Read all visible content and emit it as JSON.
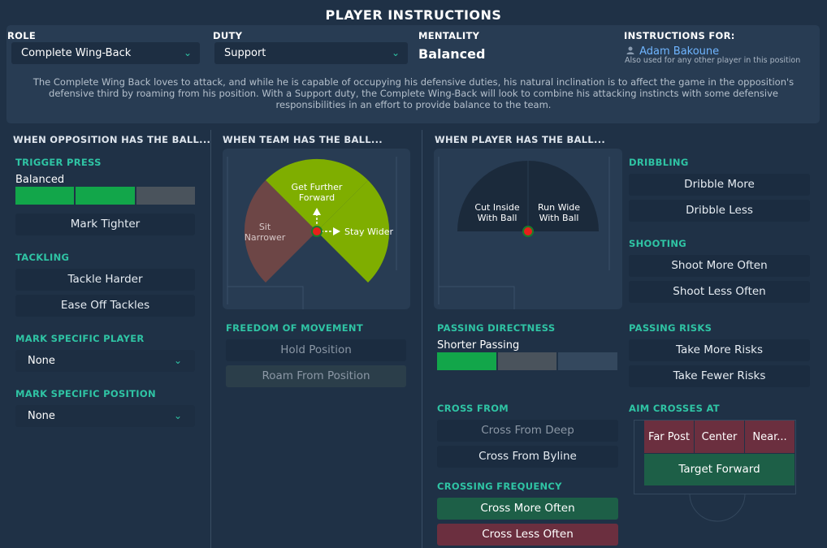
{
  "title": "PLAYER INSTRUCTIONS",
  "role": {
    "label": "ROLE",
    "value": "Complete Wing-Back"
  },
  "duty": {
    "label": "DUTY",
    "value": "Support"
  },
  "mentality": {
    "label": "MENTALITY",
    "value": "Balanced"
  },
  "instructions_for": {
    "label": "INSTRUCTIONS FOR:",
    "player": "Adam Bakoune",
    "note": "Also used for any other player in this position"
  },
  "description_1": "The Complete Wing Back loves to attack, and while he is capable of occupying his defensive duties, his natural inclination is to affect the game in the opposition's",
  "description_2": "defensive third by roaming from his position. With a Support duty, the Complete Wing-Back will look to combine his attacking instincts with some defensive",
  "description_3": "responsibilities in an effort to provide balance to the team.",
  "opposition": {
    "heading": "WHEN OPPOSITION HAS THE BALL...",
    "trigger_press": {
      "label": "TRIGGER PRESS",
      "value": "Balanced",
      "level_filled": 2,
      "level_total": 3
    },
    "mark_tighter": "Mark Tighter",
    "tackling": {
      "label": "TACKLING",
      "harder": "Tackle Harder",
      "easeoff": "Ease Off Tackles"
    },
    "mark_player": {
      "label": "MARK SPECIFIC PLAYER",
      "value": "None"
    },
    "mark_position": {
      "label": "MARK SPECIFIC POSITION",
      "value": "None"
    }
  },
  "team": {
    "heading": "WHEN TEAM HAS THE BALL...",
    "pitch_labels": {
      "forward_1": "Get Further",
      "forward_2": "Forward",
      "narrow_1": "Sit",
      "narrow_2": "Narrower",
      "wider": "Stay Wider"
    },
    "freedom": {
      "label": "FREEDOM OF MOVEMENT",
      "hold": "Hold Position",
      "roam": "Roam From Position"
    }
  },
  "player": {
    "heading": "WHEN PLAYER HAS THE BALL...",
    "pitch_labels": {
      "inside_1": "Cut Inside",
      "inside_2": "With Ball",
      "wide_1": "Run Wide",
      "wide_2": "With Ball"
    },
    "passing_directness": {
      "label": "PASSING DIRECTNESS",
      "value": "Shorter Passing",
      "level_filled": 1,
      "level_total": 3
    },
    "cross_from": {
      "label": "CROSS FROM",
      "deep": "Cross From Deep",
      "byline": "Cross From Byline"
    },
    "crossing_frequency": {
      "label": "CROSSING FREQUENCY",
      "more": "Cross More Often",
      "less": "Cross Less Often"
    },
    "dribbling": {
      "label": "DRIBBLING",
      "more": "Dribble More",
      "less": "Dribble Less"
    },
    "shooting": {
      "label": "SHOOTING",
      "more": "Shoot More Often",
      "less": "Shoot Less Often"
    },
    "passing_risks": {
      "label": "PASSING RISKS",
      "more": "Take More Risks",
      "fewer": "Take Fewer Risks"
    },
    "aim_crosses": {
      "label": "AIM CROSSES AT",
      "far": "Far Post",
      "center": "Center",
      "near": "Near...",
      "target": "Target Forward"
    }
  },
  "colors": {
    "accent": "#2fc4a4",
    "green": "#7fae00",
    "red": "#6d4646",
    "bar_green": "#12a64a"
  }
}
